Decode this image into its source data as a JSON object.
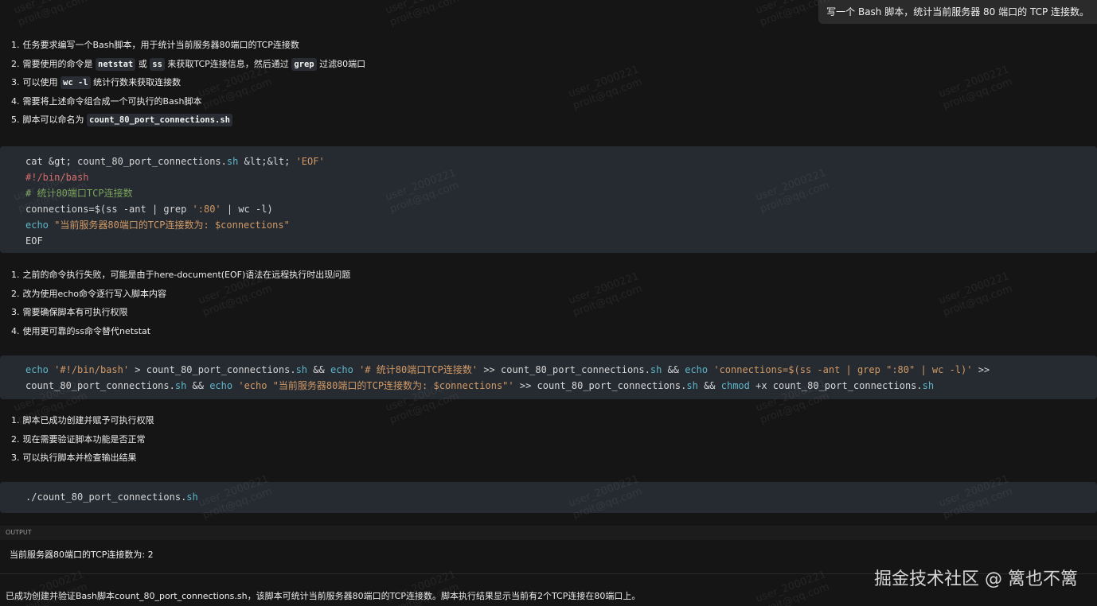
{
  "user_message": "写一个 Bash 脚本，统计当前服务器 80 端口的 TCP 连接数。",
  "list1": [
    {
      "n": "1.",
      "parts": [
        {
          "t": "任务要求编写一个Bash脚本，用于统计当前服务器80端口的TCP连接数"
        }
      ]
    },
    {
      "n": "2.",
      "parts": [
        {
          "t": "需要使用的命令是 "
        },
        {
          "c": "netstat"
        },
        {
          "t": " 或 "
        },
        {
          "c": "ss"
        },
        {
          "t": " 来获取TCP连接信息，然后通过 "
        },
        {
          "c": "grep"
        },
        {
          "t": " 过滤80端口"
        }
      ]
    },
    {
      "n": "3.",
      "parts": [
        {
          "t": "可以使用 "
        },
        {
          "c": "wc -l"
        },
        {
          "t": " 统计行数来获取连接数"
        }
      ]
    },
    {
      "n": "4.",
      "parts": [
        {
          "t": "需要将上述命令组合成一个可执行的Bash脚本"
        }
      ]
    },
    {
      "n": "5.",
      "parts": [
        {
          "t": "脚本可以命名为 "
        },
        {
          "c": "count_80_port_connections.sh"
        }
      ]
    }
  ],
  "code1": [
    [
      {
        "t": "cat &gt; count_80_port_connections."
      },
      {
        "t": "sh",
        "k": "kw"
      },
      {
        "t": " &lt;&lt; "
      },
      {
        "t": "'EOF'",
        "k": "str"
      }
    ],
    [
      {
        "t": "#!/bin/bash",
        "k": "pre"
      }
    ],
    [
      {
        "t": "# 统计80端口TCP连接数",
        "k": "cm"
      }
    ],
    [
      {
        "t": "connections=$(ss -ant | grep "
      },
      {
        "t": "':80'",
        "k": "str"
      },
      {
        "t": " | wc -l)"
      }
    ],
    [
      {
        "t": "echo",
        "k": "kw"
      },
      {
        "t": " "
      },
      {
        "t": "\"当前服务器80端口的TCP连接数为: $connections\"",
        "k": "str"
      }
    ],
    [
      {
        "t": "EOF"
      }
    ]
  ],
  "list2": [
    {
      "n": "1.",
      "parts": [
        {
          "t": "之前的命令执行失败，可能是由于here-document(EOF)语法在远程执行时出现问题"
        }
      ]
    },
    {
      "n": "2.",
      "parts": [
        {
          "t": "改为使用echo命令逐行写入脚本内容"
        }
      ]
    },
    {
      "n": "3.",
      "parts": [
        {
          "t": "需要确保脚本有可执行权限"
        }
      ]
    },
    {
      "n": "4.",
      "parts": [
        {
          "t": "使用更可靠的ss命令替代netstat"
        }
      ]
    }
  ],
  "code2": [
    [
      {
        "t": "echo",
        "k": "kw"
      },
      {
        "t": " "
      },
      {
        "t": "'#!/bin/bash'",
        "k": "str"
      },
      {
        "t": " > count_80_port_connections."
      },
      {
        "t": "sh",
        "k": "kw"
      },
      {
        "t": " && "
      },
      {
        "t": "echo",
        "k": "kw"
      },
      {
        "t": " "
      },
      {
        "t": "'# 统计80端口TCP连接数'",
        "k": "str"
      },
      {
        "t": " >> count_80_port_connections."
      },
      {
        "t": "sh",
        "k": "kw"
      },
      {
        "t": " && "
      },
      {
        "t": "echo",
        "k": "kw"
      },
      {
        "t": " "
      },
      {
        "t": "'connections=$(ss -ant | grep \":80\" | wc -l)'",
        "k": "str"
      },
      {
        "t": " >>"
      }
    ],
    [
      {
        "t": "count_80_port_connections."
      },
      {
        "t": "sh",
        "k": "kw"
      },
      {
        "t": " && "
      },
      {
        "t": "echo",
        "k": "kw"
      },
      {
        "t": " "
      },
      {
        "t": "'echo \"当前服务器80端口的TCP连接数为: $connections\"'",
        "k": "str"
      },
      {
        "t": " >> count_80_port_connections."
      },
      {
        "t": "sh",
        "k": "kw"
      },
      {
        "t": " && "
      },
      {
        "t": "chmod",
        "k": "kw"
      },
      {
        "t": " +x count_80_port_connections."
      },
      {
        "t": "sh",
        "k": "kw"
      }
    ]
  ],
  "list3": [
    {
      "n": "1.",
      "parts": [
        {
          "t": "脚本已成功创建并赋予可执行权限"
        }
      ]
    },
    {
      "n": "2.",
      "parts": [
        {
          "t": "现在需要验证脚本功能是否正常"
        }
      ]
    },
    {
      "n": "3.",
      "parts": [
        {
          "t": "可以执行脚本并检查输出结果"
        }
      ]
    }
  ],
  "code3": [
    [
      {
        "t": "./count_80_port_connections."
      },
      {
        "t": "sh",
        "k": "kw"
      }
    ]
  ],
  "output": {
    "label": "OUTPUT",
    "text": "当前服务器80端口的TCP连接数为: 2"
  },
  "summary": "已成功创建并验证Bash脚本count_80_port_connections.sh，该脚本可统计当前服务器80端口的TCP连接数。脚本执行结果显示当前有2个TCP连接在80端口上。",
  "watermark": {
    "line1": "user_2000221",
    "line2": "proit@qq.com"
  },
  "brand": "掘金技术社区 @ 篱也不篱"
}
